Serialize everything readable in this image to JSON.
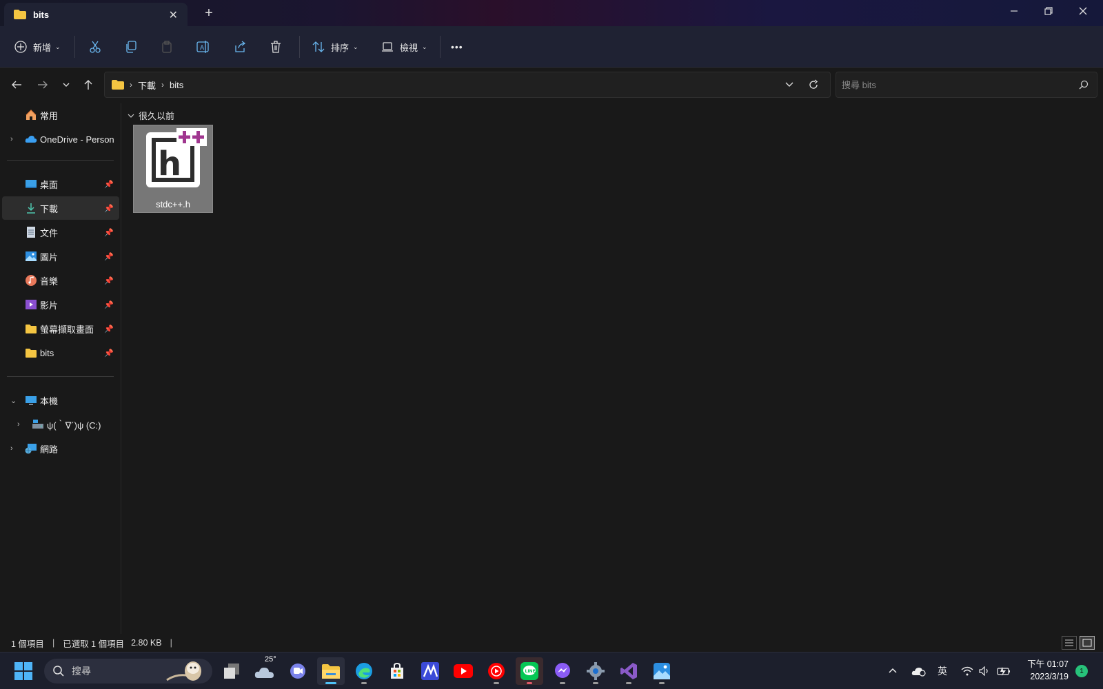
{
  "window": {
    "tab_title": "bits",
    "close_tab": "✕",
    "new_tab": "+"
  },
  "toolbar": {
    "new_label": "新增",
    "sort_label": "排序",
    "view_label": "檢視",
    "more_label": "•••"
  },
  "address": {
    "crumbs": [
      "下載",
      "bits"
    ],
    "search_placeholder": "搜尋 bits"
  },
  "sidebar": {
    "home": "常用",
    "onedrive": "OneDrive - Person",
    "pinned": [
      {
        "label": "桌面"
      },
      {
        "label": "下載"
      },
      {
        "label": "文件"
      },
      {
        "label": "圖片"
      },
      {
        "label": "音樂"
      },
      {
        "label": "影片"
      },
      {
        "label": "螢幕擷取畫面"
      },
      {
        "label": "bits"
      }
    ],
    "this_pc": "本機",
    "drive": "ψ(｀∇´)ψ (C:)",
    "network": "網路"
  },
  "content": {
    "group_header": "很久以前",
    "files": [
      {
        "name": "stdc++.h",
        "selected": true
      }
    ]
  },
  "status": {
    "item_count": "1 個項目",
    "selected": "已選取 1 個項目",
    "size": "2.80 KB"
  },
  "taskbar": {
    "search_label": "搜尋",
    "weather_temp": "25°",
    "ime": "英",
    "time": "下午 01:07",
    "date": "2023/3/19",
    "notifications": "1"
  },
  "colors": {
    "accent": "#4fc3f7",
    "folder": "#f4c542",
    "header_purple": "#a0368f"
  }
}
